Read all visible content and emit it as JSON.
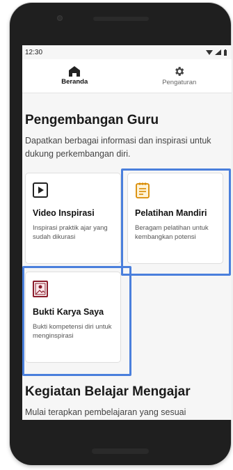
{
  "status_bar": {
    "time": "12:30"
  },
  "tabs": [
    {
      "label": "Beranda",
      "icon": "home-icon",
      "active": true
    },
    {
      "label": "Pengaturan",
      "icon": "gear-icon",
      "active": false
    }
  ],
  "section1": {
    "title": "Pengembangan Guru",
    "description": "Dapatkan berbagai informasi dan inspirasi untuk dukung perkembangan diri."
  },
  "cards": [
    {
      "title": "Video Inspirasi",
      "description": "Inspirasi praktik ajar yang sudah dikurasi",
      "icon": "video-play-icon"
    },
    {
      "title": "Pelatihan Mandiri",
      "description": "Beragam pelatihan untuk kembangkan potensi",
      "icon": "notepad-icon"
    },
    {
      "title": "Bukti Karya Saya",
      "description": "Bukti kompetensi diri untuk menginspirasi",
      "icon": "certificate-icon"
    }
  ],
  "section2": {
    "title": "Kegiatan Belajar Mengajar",
    "description": "Mulai terapkan pembelajaran yang sesuai"
  },
  "colors": {
    "highlight": "#4a7fdc",
    "phone_frame": "#1f1f1f",
    "screen_bg": "#f6f6f6"
  }
}
